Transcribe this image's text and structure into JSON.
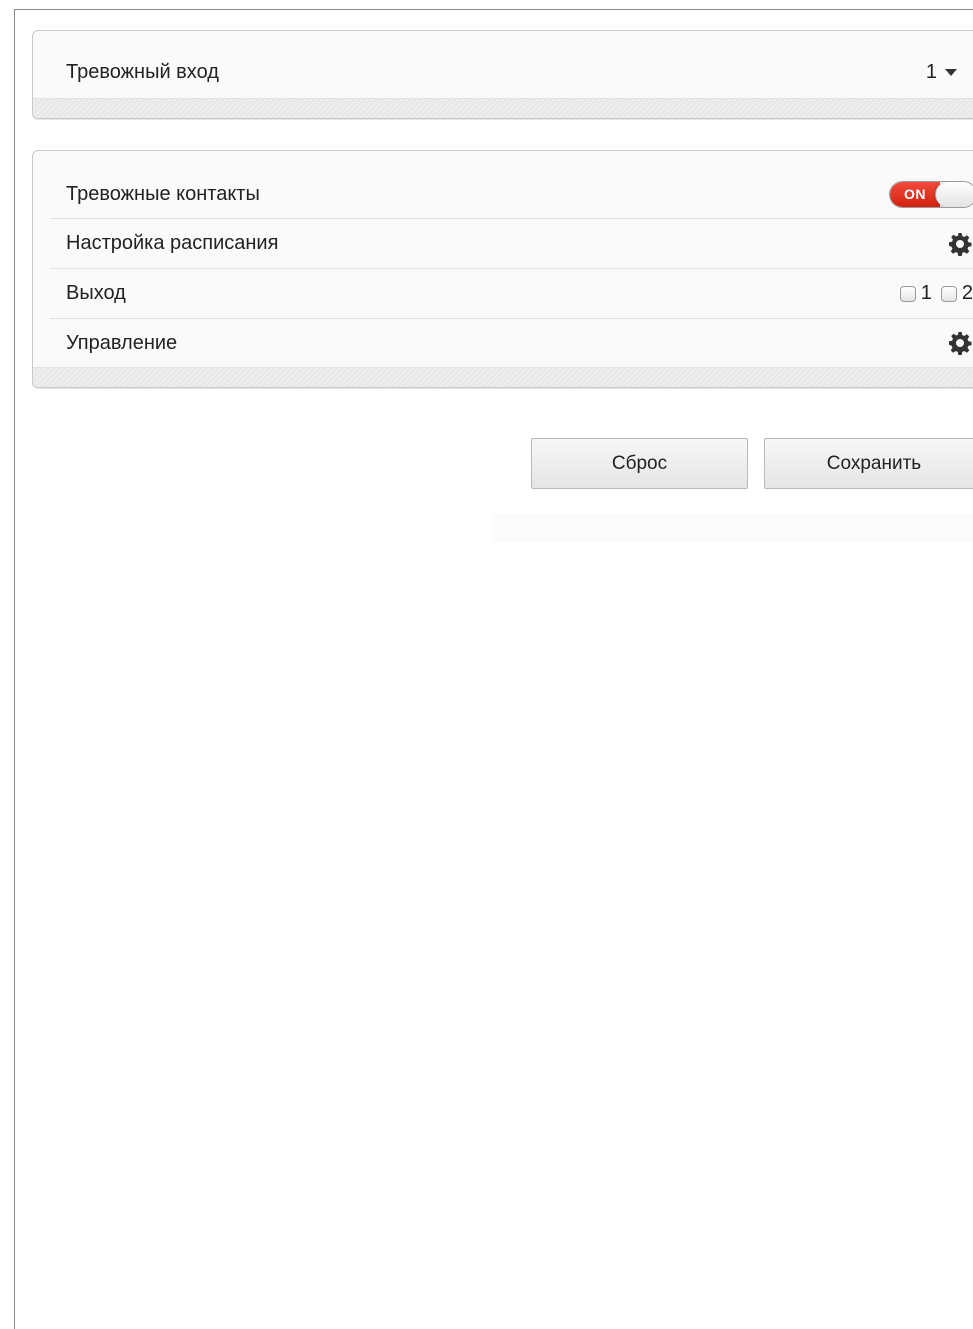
{
  "alarm_input": {
    "label": "Тревожный вход",
    "selected_value": "1"
  },
  "settings": {
    "alarm_contacts": {
      "label": "Тревожные контакты",
      "toggle_text": "ON",
      "toggle_state": "on",
      "toggle_color": "#e2291b"
    },
    "schedule": {
      "label": "Настройка расписания",
      "icon": "gear-icon"
    },
    "output": {
      "label": "Выход",
      "options": [
        {
          "label": "1",
          "checked": false
        },
        {
          "label": "2",
          "checked": false
        }
      ]
    },
    "control": {
      "label": "Управление",
      "icon": "gear-icon"
    }
  },
  "buttons": {
    "reset_label": "Сброс",
    "save_label": "Сохранить"
  }
}
